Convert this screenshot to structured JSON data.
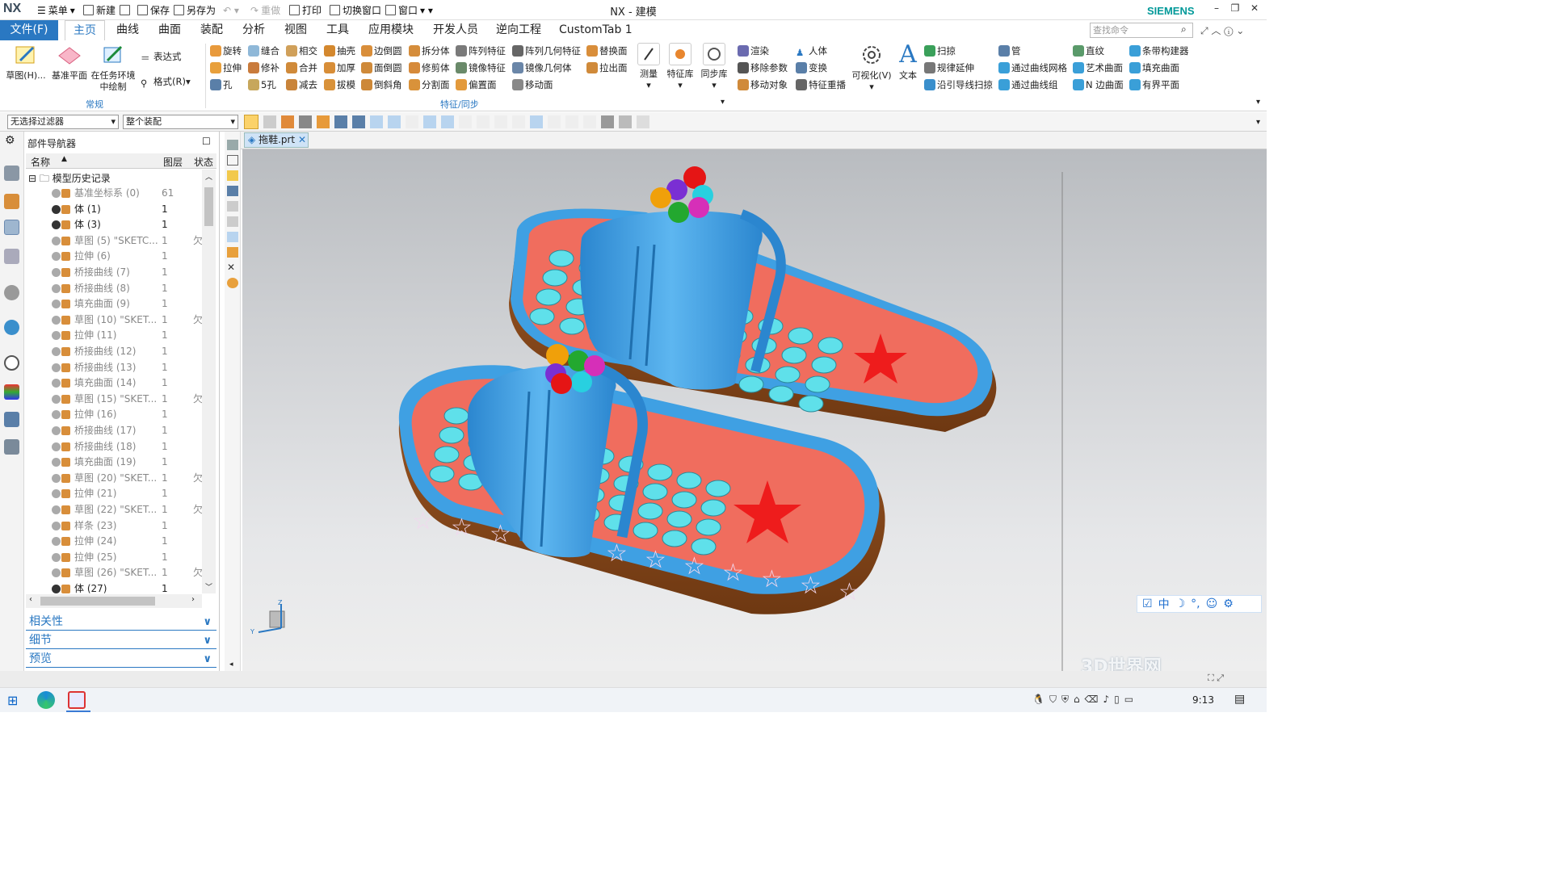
{
  "app": {
    "logo": "NX",
    "title": "NX - 建模",
    "brand": "SIEMENS",
    "search_placeholder": "查找命令"
  },
  "quick_access": [
    "菜单",
    "新建",
    "保存",
    "另存为",
    "重做",
    "打印",
    "切换窗口",
    "窗口"
  ],
  "tabs": [
    "文件(F)",
    "主页",
    "曲线",
    "曲面",
    "装配",
    "分析",
    "视图",
    "工具",
    "应用模块",
    "开发人员",
    "逆向工程",
    "CustomTab 1"
  ],
  "active_tab": "主页",
  "ribbon": {
    "big_buttons": [
      "草图(H)...",
      "基准平面",
      "在任务环境中绘制"
    ],
    "general": [
      "表达式",
      "格式(R)"
    ],
    "general_label": "常规",
    "feature_col1": [
      "旋转",
      "拉伸",
      "孔"
    ],
    "feature_col2": [
      "缝合",
      "修补",
      "5孔"
    ],
    "feature_col3": [
      "相交",
      "合并",
      "减去"
    ],
    "feature_col4": [
      "抽壳",
      "加厚",
      "拔模"
    ],
    "feature_col5": [
      "边倒圆",
      "面倒圆",
      "倒斜角"
    ],
    "feature_col6": [
      "拆分体",
      "修剪体",
      "分割面"
    ],
    "feature_col7": [
      "阵列特征",
      "镜像特征",
      "偏置面"
    ],
    "feature_col8": [
      "阵列几何特征",
      "镜像几何体",
      "移动面"
    ],
    "feature_col9": [
      "替换面",
      "拉出面"
    ],
    "feature_label": "特征/同步",
    "tools": [
      "测量",
      "特征库",
      "同步库"
    ],
    "edit_col1": [
      "渲染",
      "移除参数",
      "移动对象"
    ],
    "edit_col2": [
      "人体",
      "变换",
      "特征重播"
    ],
    "visualize": "可视化(V)",
    "text": "文本",
    "surf_col1": [
      "扫掠",
      "规律延伸",
      "沿引导线扫掠"
    ],
    "surf_col2": [
      "管",
      "通过曲线网格",
      "通过曲线组"
    ],
    "surf_col3": [
      "直纹",
      "艺术曲面",
      "N 边曲面"
    ],
    "surf_col4": [
      "条带构建器",
      "填充曲面",
      "有界平面"
    ]
  },
  "selection": {
    "filter": "无选择过滤器",
    "scope": "整个装配"
  },
  "navigator": {
    "title": "部件导航器",
    "headers": {
      "name": "名称",
      "layer": "图层",
      "status": "状态"
    },
    "root": "模型历史记录",
    "rows": [
      {
        "name": "基准坐标系 (0)",
        "layer": "61",
        "status": "",
        "dim": true
      },
      {
        "name": "体 (1)",
        "layer": "1",
        "status": "",
        "dim": false
      },
      {
        "name": "体 (3)",
        "layer": "1",
        "status": "",
        "dim": false
      },
      {
        "name": "草图 (5) \"SKETC...",
        "layer": "1",
        "status": "欠",
        "dim": true
      },
      {
        "name": "拉伸 (6)",
        "layer": "1",
        "status": "",
        "dim": true
      },
      {
        "name": "桥接曲线 (7)",
        "layer": "1",
        "status": "",
        "dim": true
      },
      {
        "name": "桥接曲线 (8)",
        "layer": "1",
        "status": "",
        "dim": true
      },
      {
        "name": "填充曲面 (9)",
        "layer": "1",
        "status": "",
        "dim": true
      },
      {
        "name": "草图 (10) \"SKET...",
        "layer": "1",
        "status": "欠",
        "dim": true
      },
      {
        "name": "拉伸 (11)",
        "layer": "1",
        "status": "",
        "dim": true
      },
      {
        "name": "桥接曲线 (12)",
        "layer": "1",
        "status": "",
        "dim": true
      },
      {
        "name": "桥接曲线 (13)",
        "layer": "1",
        "status": "",
        "dim": true
      },
      {
        "name": "填充曲面 (14)",
        "layer": "1",
        "status": "",
        "dim": true
      },
      {
        "name": "草图 (15) \"SKET...",
        "layer": "1",
        "status": "欠",
        "dim": true
      },
      {
        "name": "拉伸 (16)",
        "layer": "1",
        "status": "",
        "dim": true
      },
      {
        "name": "桥接曲线 (17)",
        "layer": "1",
        "status": "",
        "dim": true
      },
      {
        "name": "桥接曲线 (18)",
        "layer": "1",
        "status": "",
        "dim": true
      },
      {
        "name": "填充曲面 (19)",
        "layer": "1",
        "status": "",
        "dim": true
      },
      {
        "name": "草图 (20) \"SKET...",
        "layer": "1",
        "status": "欠",
        "dim": true
      },
      {
        "name": "拉伸 (21)",
        "layer": "1",
        "status": "",
        "dim": true
      },
      {
        "name": "草图 (22) \"SKET...",
        "layer": "1",
        "status": "欠",
        "dim": true
      },
      {
        "name": "样条 (23)",
        "layer": "1",
        "status": "",
        "dim": true
      },
      {
        "name": "拉伸 (24)",
        "layer": "1",
        "status": "",
        "dim": true
      },
      {
        "name": "拉伸 (25)",
        "layer": "1",
        "status": "",
        "dim": true
      },
      {
        "name": "草图 (26) \"SKET...",
        "layer": "1",
        "status": "欠",
        "dim": true
      },
      {
        "name": "体 (27)",
        "layer": "1",
        "status": "",
        "dim": false
      }
    ],
    "panes": [
      "相关性",
      "细节",
      "预览"
    ]
  },
  "document_tab": "拖鞋.prt",
  "ime": {
    "lang": "中"
  },
  "watermark": "3D世界网",
  "taskbar": {
    "time": "9:13"
  },
  "colors": {
    "accent": "#2a78c2",
    "brand": "#009999",
    "sole_top": "#f06d5e",
    "strap": "#3fa0e3",
    "dots": "#5fe0ea",
    "sole_side": "#8a4b1e",
    "star": "#ee1c1c"
  }
}
